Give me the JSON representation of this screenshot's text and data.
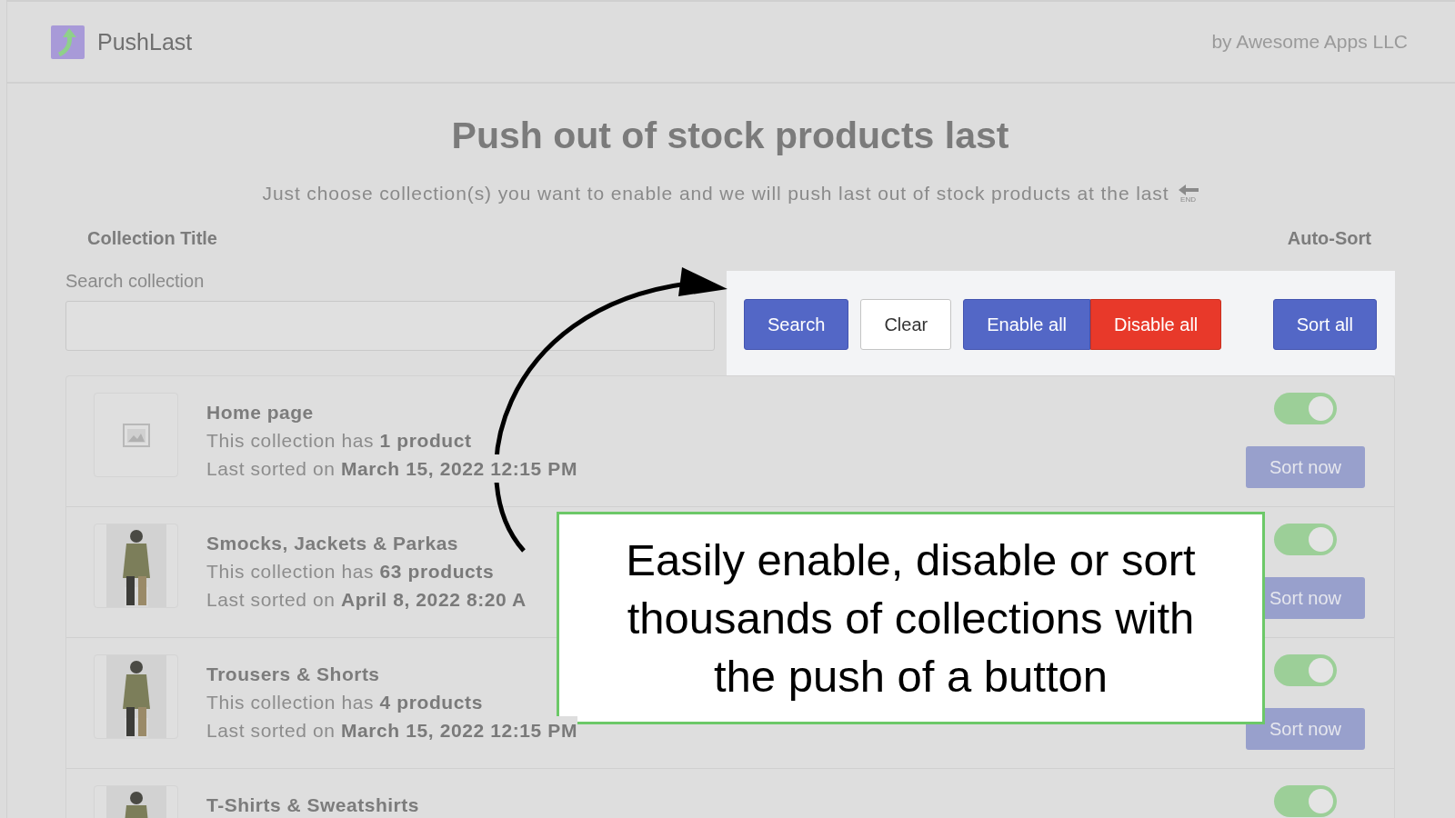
{
  "header": {
    "app_name": "PushLast",
    "vendor": "by Awesome Apps LLC"
  },
  "title": "Push out of stock products last",
  "subtitle": {
    "text": "Just choose collection(s) you want to enable and we will push last out of stock products at the last",
    "icon_label": "END"
  },
  "columns": {
    "left": "Collection Title",
    "right": "Auto-Sort"
  },
  "search": {
    "label": "Search collection"
  },
  "buttons": [
    {
      "label": "Search",
      "kind": "primary"
    },
    {
      "label": "Clear",
      "kind": "plain"
    },
    {
      "label": "Enable all",
      "kind": "primary"
    },
    {
      "label": "Disable all",
      "kind": "danger"
    },
    {
      "label": "Sort all",
      "kind": "primary"
    }
  ],
  "collections": [
    {
      "title": "Home page",
      "kind": "placeholder",
      "count": "This collection has **1 product**",
      "sorted": "Last sorted on **March 15, 2022 12:15 PM**",
      "enabled": true,
      "sort_button": "Sort now"
    },
    {
      "title": "Smocks, Jackets & Parkas",
      "kind": "picture",
      "count": "This collection has **63 products**",
      "sorted": "Last sorted on **April 8, 2022 8:20 A**",
      "enabled": true,
      "sort_button": "Sort now"
    },
    {
      "title": "Trousers & Shorts",
      "kind": "picture",
      "count": "This collection has **4 products**",
      "sorted": "Last sorted on **March 15, 2022 12:15 PM**",
      "enabled": true,
      "sort_button": "Sort now"
    },
    {
      "title": "T-Shirts & Sweatshirts",
      "kind": "picture",
      "enabled": true
    }
  ],
  "callout": {
    "text": "Easily enable, disable or sort thousands of collections with the push of a button"
  }
}
